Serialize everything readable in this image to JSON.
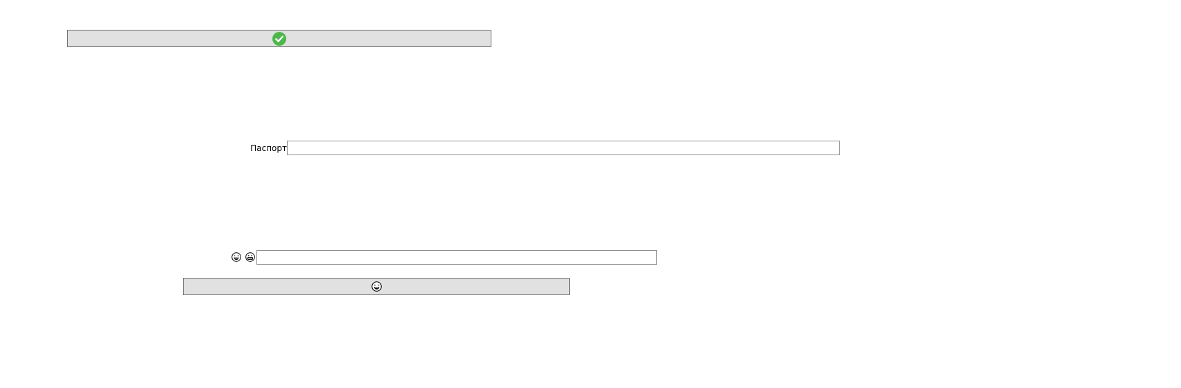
{
  "buttons": {
    "top": {
      "icon": "green-checkmark-icon",
      "color": "#4cb848"
    },
    "bottom": {
      "icon": "laughing-face-icon"
    }
  },
  "passport_field": {
    "label": "Паспорт",
    "value": ""
  },
  "emoji_field": {
    "icons": [
      "laughing-face-icon",
      "grinning-face-icon"
    ],
    "value": ""
  }
}
